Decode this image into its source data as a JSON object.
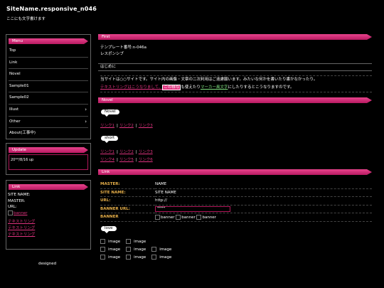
{
  "site": {
    "title": "SiteName.responsive_n046",
    "subtitle": "ここにも文字書けます"
  },
  "sidebar": {
    "menu_title": "Menu",
    "menu_items": [
      {
        "label": "Top",
        "has_submenu": false
      },
      {
        "label": "Link",
        "has_submenu": false
      },
      {
        "label": "Novel",
        "has_submenu": false
      },
      {
        "label": "Sample01",
        "has_submenu": false
      },
      {
        "label": "Sample02",
        "has_submenu": false
      },
      {
        "label": "Illust",
        "has_submenu": true
      },
      {
        "label": "Other",
        "has_submenu": true
      },
      {
        "label": "About(工事中)",
        "has_submenu": false
      }
    ],
    "update_title": "Update",
    "update_text": "20**/8/16 up",
    "link_title": "Link",
    "link_lines": [
      "SITE NAME:",
      "MASTER:",
      "URL:"
    ],
    "banner_alt": "banner",
    "text_links": [
      "テキストリング",
      "テキストリング",
      "テキストリング"
    ],
    "designed": "designed"
  },
  "main": {
    "first_title": "First",
    "first_lines": [
      "テンプレート番号:n-046a",
      "レスポンシブ"
    ],
    "intro_heading": "はじめに",
    "intro_line1": "当サイトは○○サイトです。サイト内の画像・文章の二次利用はご遠慮願います。みたいな何かを書いたり書かなかったり。",
    "intro_line2_a": "テキストリングはこうなりまして、",
    "intro_line2_hl": "この様な",
    "intro_line2_b": "も使えたり",
    "intro_line2_under": "マーカー風文字",
    "intro_line2_c": "にしたりするとこうなりますのです。",
    "novel_title": "Novel",
    "short_label": "short",
    "novel_rows": [
      [
        "リンク1",
        "リンク2",
        "リンク3"
      ]
    ],
    "short_rows": [
      [
        "リンク1",
        "リンク2",
        "リンク3"
      ],
      [
        "リンク4",
        "リンク5",
        "リンク6"
      ]
    ],
    "link_title": "Link",
    "info_rows": [
      {
        "key": "MASTER:",
        "value": "NAME"
      },
      {
        "key": "SITE NAME:",
        "value": "SITE NAME"
      },
      {
        "key": "URL:",
        "value": "http://"
      },
      {
        "key": "BANNER URL:",
        "value": "*****"
      },
      {
        "key": "BANNER",
        "value": "banner"
      }
    ],
    "love_label": "love",
    "image_alt": "image"
  }
}
